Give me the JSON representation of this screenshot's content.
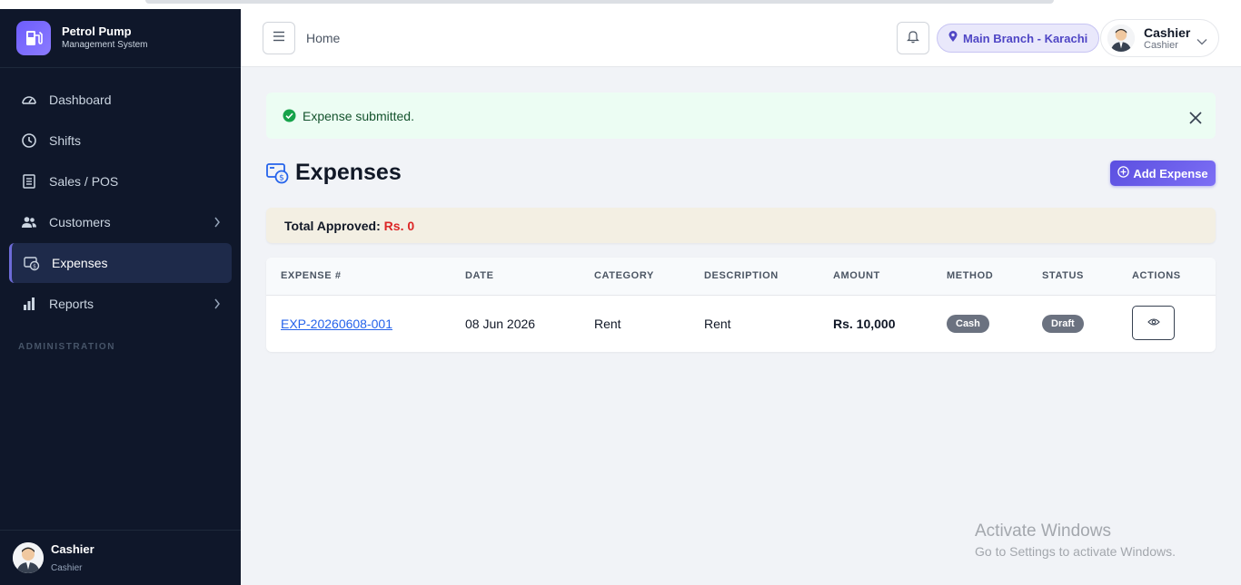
{
  "brand": {
    "title": "Petrol Pump",
    "subtitle": "Management System"
  },
  "sidebar": {
    "items": [
      {
        "label": "Dashboard",
        "icon": "dashboard-icon"
      },
      {
        "label": "Shifts",
        "icon": "clock-icon"
      },
      {
        "label": "Sales / POS",
        "icon": "receipt-icon"
      },
      {
        "label": "Customers",
        "icon": "users-icon",
        "has_submenu": true
      },
      {
        "label": "Expenses",
        "icon": "expenses-icon",
        "active": true
      },
      {
        "label": "Reports",
        "icon": "bar-chart-icon",
        "has_submenu": true
      }
    ],
    "section_label": "ADMINISTRATION",
    "user": {
      "name": "Cashier",
      "role": "Cashier"
    }
  },
  "header": {
    "breadcrumb": "Home",
    "branch": "Main Branch - Karachi",
    "user": {
      "name": "Cashier",
      "role": "Cashier"
    }
  },
  "alert": {
    "message": "Expense submitted."
  },
  "page": {
    "title": "Expenses",
    "add_button": "Add Expense",
    "total_label": "Total Approved:",
    "total_value": "Rs. 0"
  },
  "table": {
    "columns": [
      "EXPENSE #",
      "DATE",
      "CATEGORY",
      "DESCRIPTION",
      "AMOUNT",
      "METHOD",
      "STATUS",
      "ACTIONS"
    ],
    "rows": [
      {
        "expense_no": "EXP-20260608-001",
        "date": "08 Jun 2026",
        "category": "Rent",
        "description": "Rent",
        "amount": "Rs. 10,000",
        "method": "Cash",
        "status": "Draft"
      }
    ]
  },
  "watermark": {
    "line1": "Activate Windows",
    "line2": "Go to Settings to activate Windows."
  },
  "colors": {
    "accent": "#6d5dfc",
    "sidebar_bg": "#0f172a",
    "success_bg": "#ecfdf3",
    "total_value": "#dc2626",
    "link": "#2563eb"
  }
}
